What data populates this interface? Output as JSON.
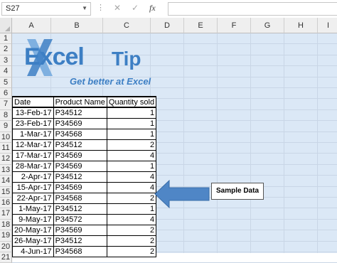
{
  "formula_bar": {
    "name_box": "S27",
    "fx_label": "fx",
    "formula_value": ""
  },
  "columns": [
    "A",
    "B",
    "C",
    "D",
    "E",
    "F",
    "G",
    "H",
    "I"
  ],
  "rows": [
    "1",
    "2",
    "3",
    "4",
    "5",
    "6",
    "7",
    "8",
    "9",
    "10",
    "11",
    "12",
    "13",
    "14",
    "15",
    "16",
    "17",
    "18",
    "19",
    "20",
    "21"
  ],
  "logo": {
    "brand": "Excel",
    "brand_suffix": "Tip",
    "tagline": "Get better at Excel"
  },
  "table": {
    "headers": [
      "Date",
      "Product Name",
      "Quantity sold"
    ],
    "rows": [
      [
        "13-Feb-17",
        "P34512",
        "1"
      ],
      [
        "23-Feb-17",
        "P34569",
        "1"
      ],
      [
        "1-Mar-17",
        "P34568",
        "1"
      ],
      [
        "12-Mar-17",
        "P34512",
        "2"
      ],
      [
        "17-Mar-17",
        "P34569",
        "4"
      ],
      [
        "28-Mar-17",
        "P34569",
        "1"
      ],
      [
        "2-Apr-17",
        "P34512",
        "4"
      ],
      [
        "15-Apr-17",
        "P34569",
        "4"
      ],
      [
        "22-Apr-17",
        "P34568",
        "2"
      ],
      [
        "1-May-17",
        "P34512",
        "1"
      ],
      [
        "9-May-17",
        "P34572",
        "4"
      ],
      [
        "20-May-17",
        "P34569",
        "2"
      ],
      [
        "26-May-17",
        "P34512",
        "2"
      ],
      [
        "4-Jun-17",
        "P34568",
        "2"
      ]
    ]
  },
  "callout": {
    "label": "Sample Data"
  },
  "colors": {
    "grid_background": "#dbe8f6",
    "logo_blue": "#3d7fc4",
    "arrow_fill": "#4f86c6"
  }
}
